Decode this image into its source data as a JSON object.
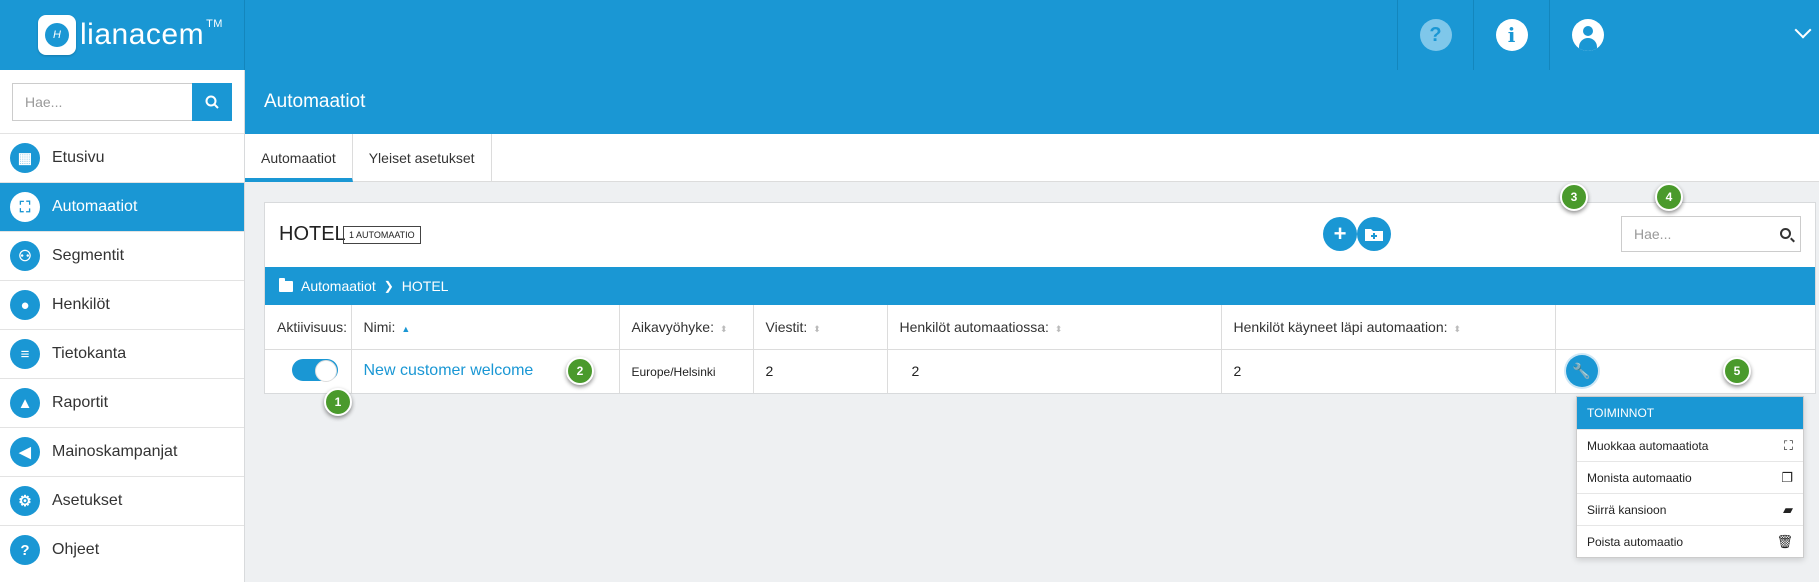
{
  "brand": {
    "name_part1": "liana",
    "name_part2": "cem",
    "tm": "TM",
    "mark": "H"
  },
  "topbar": {
    "help_glyph": "?",
    "info_glyph": "i"
  },
  "sidebar": {
    "search_placeholder": "Hae...",
    "items": [
      {
        "label": "Etusivu",
        "icon": "dashboard-icon",
        "glyph": "▦",
        "active": false
      },
      {
        "label": "Automaatiot",
        "icon": "hierarchy-icon",
        "glyph": "⛶",
        "active": true
      },
      {
        "label": "Segmentit",
        "icon": "users-icon",
        "glyph": "⚇",
        "active": false
      },
      {
        "label": "Henkilöt",
        "icon": "user-icon",
        "glyph": "●",
        "active": false
      },
      {
        "label": "Tietokanta",
        "icon": "database-icon",
        "glyph": "≡",
        "active": false
      },
      {
        "label": "Raportit",
        "icon": "chart-icon",
        "glyph": "▲",
        "active": false
      },
      {
        "label": "Mainoskampanjat",
        "icon": "megaphone-icon",
        "glyph": "◀",
        "active": false
      },
      {
        "label": "Asetukset",
        "icon": "gears-icon",
        "glyph": "⚙",
        "active": false
      },
      {
        "label": "Ohjeet",
        "icon": "question-icon",
        "glyph": "?",
        "active": false
      }
    ]
  },
  "header": {
    "title": "Automaatiot"
  },
  "tabs": [
    {
      "label": "Automaatiot",
      "active": true
    },
    {
      "label": "Yleiset asetukset",
      "active": false
    }
  ],
  "panel": {
    "title": "HOTEL",
    "count_badge": "1 AUTOMAATIO",
    "search_placeholder": "Hae...",
    "breadcrumb": [
      "Automaatiot",
      "HOTEL"
    ],
    "columns": [
      "Aktiivisuus:",
      "Nimi:",
      "Aikavyöhyke:",
      "Viestit:",
      "Henkilöt automaatiossa:",
      "Henkilöt käyneet läpi automaation:"
    ],
    "rows": [
      {
        "active": true,
        "name": "New customer welcome",
        "timezone": "Europe/Helsinki",
        "messages": "2",
        "in_automation": "2",
        "passed": "2"
      }
    ]
  },
  "markers": [
    "1",
    "2",
    "3",
    "4",
    "5"
  ],
  "actions_menu": {
    "title": "TOIMINNOT",
    "items": [
      {
        "label": "Muokkaa automaatiota",
        "icon": "hierarchy-icon",
        "glyph": "⛶"
      },
      {
        "label": "Monista automaatio",
        "icon": "copy-icon",
        "glyph": "❐"
      },
      {
        "label": "Siirrä kansioon",
        "icon": "folder-open-icon",
        "glyph": "▰"
      },
      {
        "label": "Poista automaatio",
        "icon": "trash-icon",
        "glyph": "🗑"
      }
    ]
  },
  "colors": {
    "primary": "#1a97d4",
    "marker": "#4a9a2c",
    "background": "#eef0f2"
  }
}
